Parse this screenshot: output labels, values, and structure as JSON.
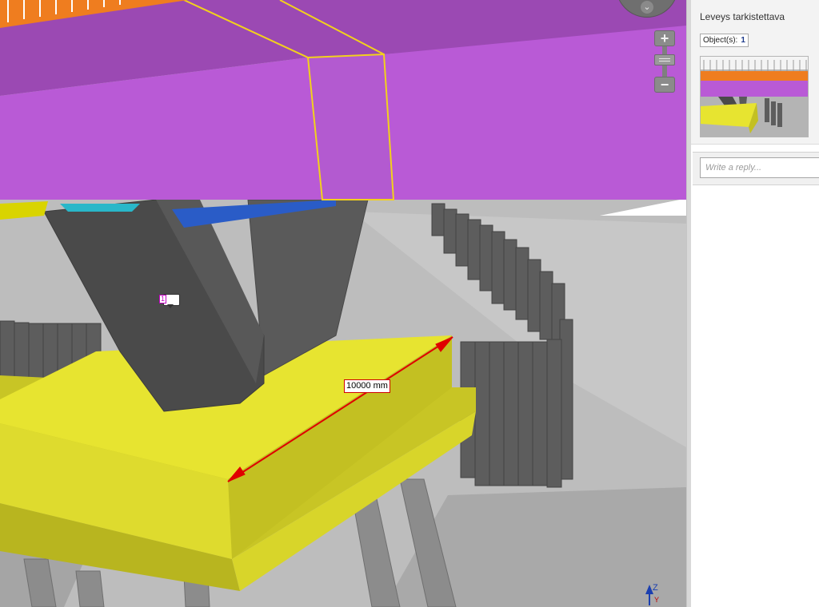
{
  "viewer": {
    "navigation_icon": "chevron-down-icon",
    "zoom_in_icon": "plus-icon",
    "zoom_out_icon": "minus-icon",
    "dimension_label": "10000 mm",
    "comment_marker_number": "1",
    "axis_z_label": "Z",
    "axis_y_label": "Y",
    "colors": {
      "deck": "#b55ad1",
      "foundation_slab": "#dcd92c",
      "pier": "#4a4a4a",
      "railing": "#ee7a1d",
      "dimension_line": "#e00000",
      "selection_outline": "#f5d21a"
    }
  },
  "panel": {
    "title": "Leveys tarkistettava",
    "objects_label": "Object(s):",
    "objects_count": "1",
    "reply_placeholder": "Write a reply..."
  }
}
